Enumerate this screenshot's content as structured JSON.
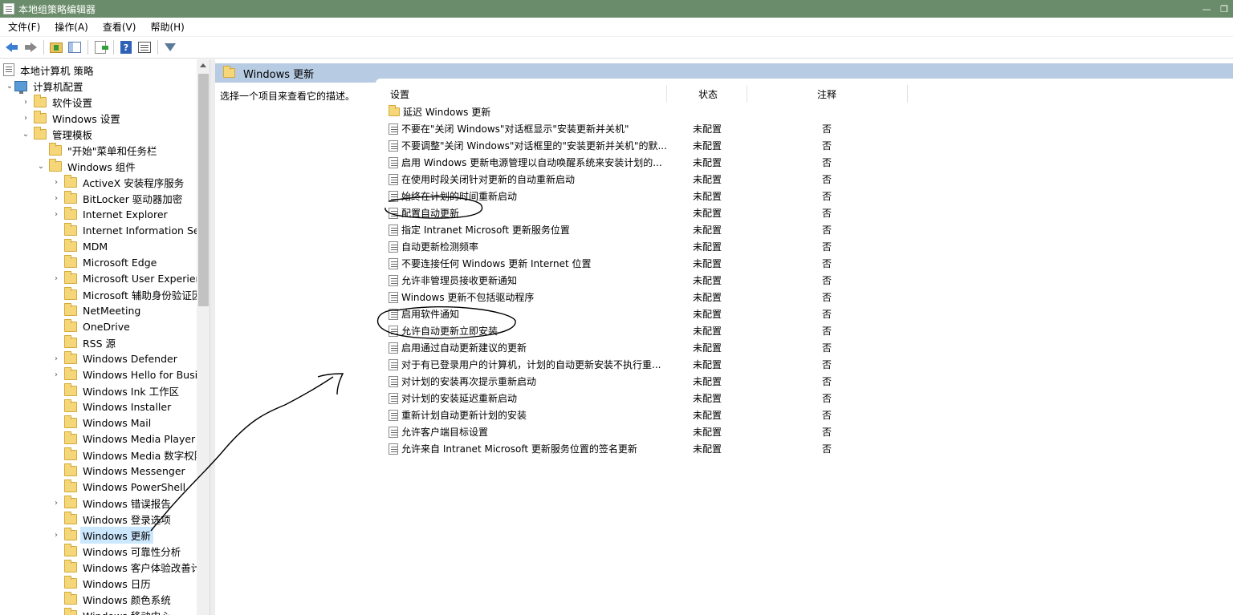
{
  "window": {
    "title": "本地组策略编辑器",
    "icon": "policy-editor-icon"
  },
  "menu": [
    "文件(F)",
    "操作(A)",
    "查看(V)",
    "帮助(H)"
  ],
  "toolbar": [
    "back-icon",
    "forward-icon",
    "up-folder-icon",
    "show-hide-tree-icon",
    "export-list-icon",
    "help-icon",
    "properties-icon",
    "filter-icon"
  ],
  "tree": {
    "root": "本地计算机 策略",
    "computer_config": "计算机配置",
    "software_settings": "软件设置",
    "windows_settings": "Windows 设置",
    "admin_templates": "管理模板",
    "start_menu": "\"开始\"菜单和任务栏",
    "windows_components": "Windows 组件",
    "children": [
      "ActiveX 安装程序服务",
      "BitLocker 驱动器加密",
      "Internet Explorer",
      "Internet Information Serv",
      "MDM",
      "Microsoft Edge",
      "Microsoft User Experienc",
      "Microsoft 辅助身份验证因",
      "NetMeeting",
      "OneDrive",
      "RSS 源",
      "Windows Defender",
      "Windows Hello for Busin",
      "Windows Ink 工作区",
      "Windows Installer",
      "Windows Mail",
      "Windows Media Player",
      "Windows Media 数字权限",
      "Windows Messenger",
      "Windows PowerShell",
      "Windows 错误报告",
      "Windows 登录选项",
      "Windows 更新",
      "Windows 可靠性分析",
      "Windows 客户体验改善计",
      "Windows 日历",
      "Windows 颜色系统",
      "Windows 移动中心"
    ],
    "expandable": [
      true,
      true,
      true,
      false,
      false,
      false,
      true,
      false,
      false,
      false,
      false,
      true,
      true,
      false,
      false,
      false,
      false,
      false,
      false,
      false,
      true,
      false,
      true,
      false,
      false,
      false,
      false,
      false
    ],
    "selected_index": 22
  },
  "right": {
    "header": "Windows 更新",
    "description": "选择一个项目来查看它的描述。",
    "columns": {
      "setting": "设置",
      "state": "状态",
      "comment": "注释"
    },
    "folder_row": "延迟 Windows 更新",
    "rows": [
      {
        "name": "不要在\"关闭 Windows\"对话框显示\"安装更新并关机\"",
        "state": "未配置",
        "comment": "否"
      },
      {
        "name": "不要调整\"关闭 Windows\"对话框里的\"安装更新并关机\"的默...",
        "state": "未配置",
        "comment": "否"
      },
      {
        "name": "启用 Windows 更新电源管理以自动唤醒系统来安装计划的...",
        "state": "未配置",
        "comment": "否"
      },
      {
        "name": "在使用时段关闭针对更新的自动重新启动",
        "state": "未配置",
        "comment": "否"
      },
      {
        "name": "始终在计划的时间重新启动",
        "state": "未配置",
        "comment": "否"
      },
      {
        "name": "配置自动更新",
        "state": "未配置",
        "comment": "否"
      },
      {
        "name": "指定 Intranet Microsoft 更新服务位置",
        "state": "未配置",
        "comment": "否"
      },
      {
        "name": "自动更新检测频率",
        "state": "未配置",
        "comment": "否"
      },
      {
        "name": "不要连接任何 Windows 更新 Internet 位置",
        "state": "未配置",
        "comment": "否"
      },
      {
        "name": "允许非管理员接收更新通知",
        "state": "未配置",
        "comment": "否"
      },
      {
        "name": "Windows 更新不包括驱动程序",
        "state": "未配置",
        "comment": "否"
      },
      {
        "name": "启用软件通知",
        "state": "未配置",
        "comment": "否"
      },
      {
        "name": "允许自动更新立即安装",
        "state": "未配置",
        "comment": "否"
      },
      {
        "name": "启用通过自动更新建议的更新",
        "state": "未配置",
        "comment": "否"
      },
      {
        "name": "对于有已登录用户的计算机，计划的自动更新安装不执行重...",
        "state": "未配置",
        "comment": "否"
      },
      {
        "name": "对计划的安装再次提示重新启动",
        "state": "未配置",
        "comment": "否"
      },
      {
        "name": "对计划的安装延迟重新启动",
        "state": "未配置",
        "comment": "否"
      },
      {
        "name": "重新计划自动更新计划的安装",
        "state": "未配置",
        "comment": "否"
      },
      {
        "name": "允许客户端目标设置",
        "state": "未配置",
        "comment": "否"
      },
      {
        "name": "允许来自 Intranet Microsoft 更新服务位置的签名更新",
        "state": "未配置",
        "comment": "否"
      }
    ]
  },
  "annotation_color": "#000000"
}
